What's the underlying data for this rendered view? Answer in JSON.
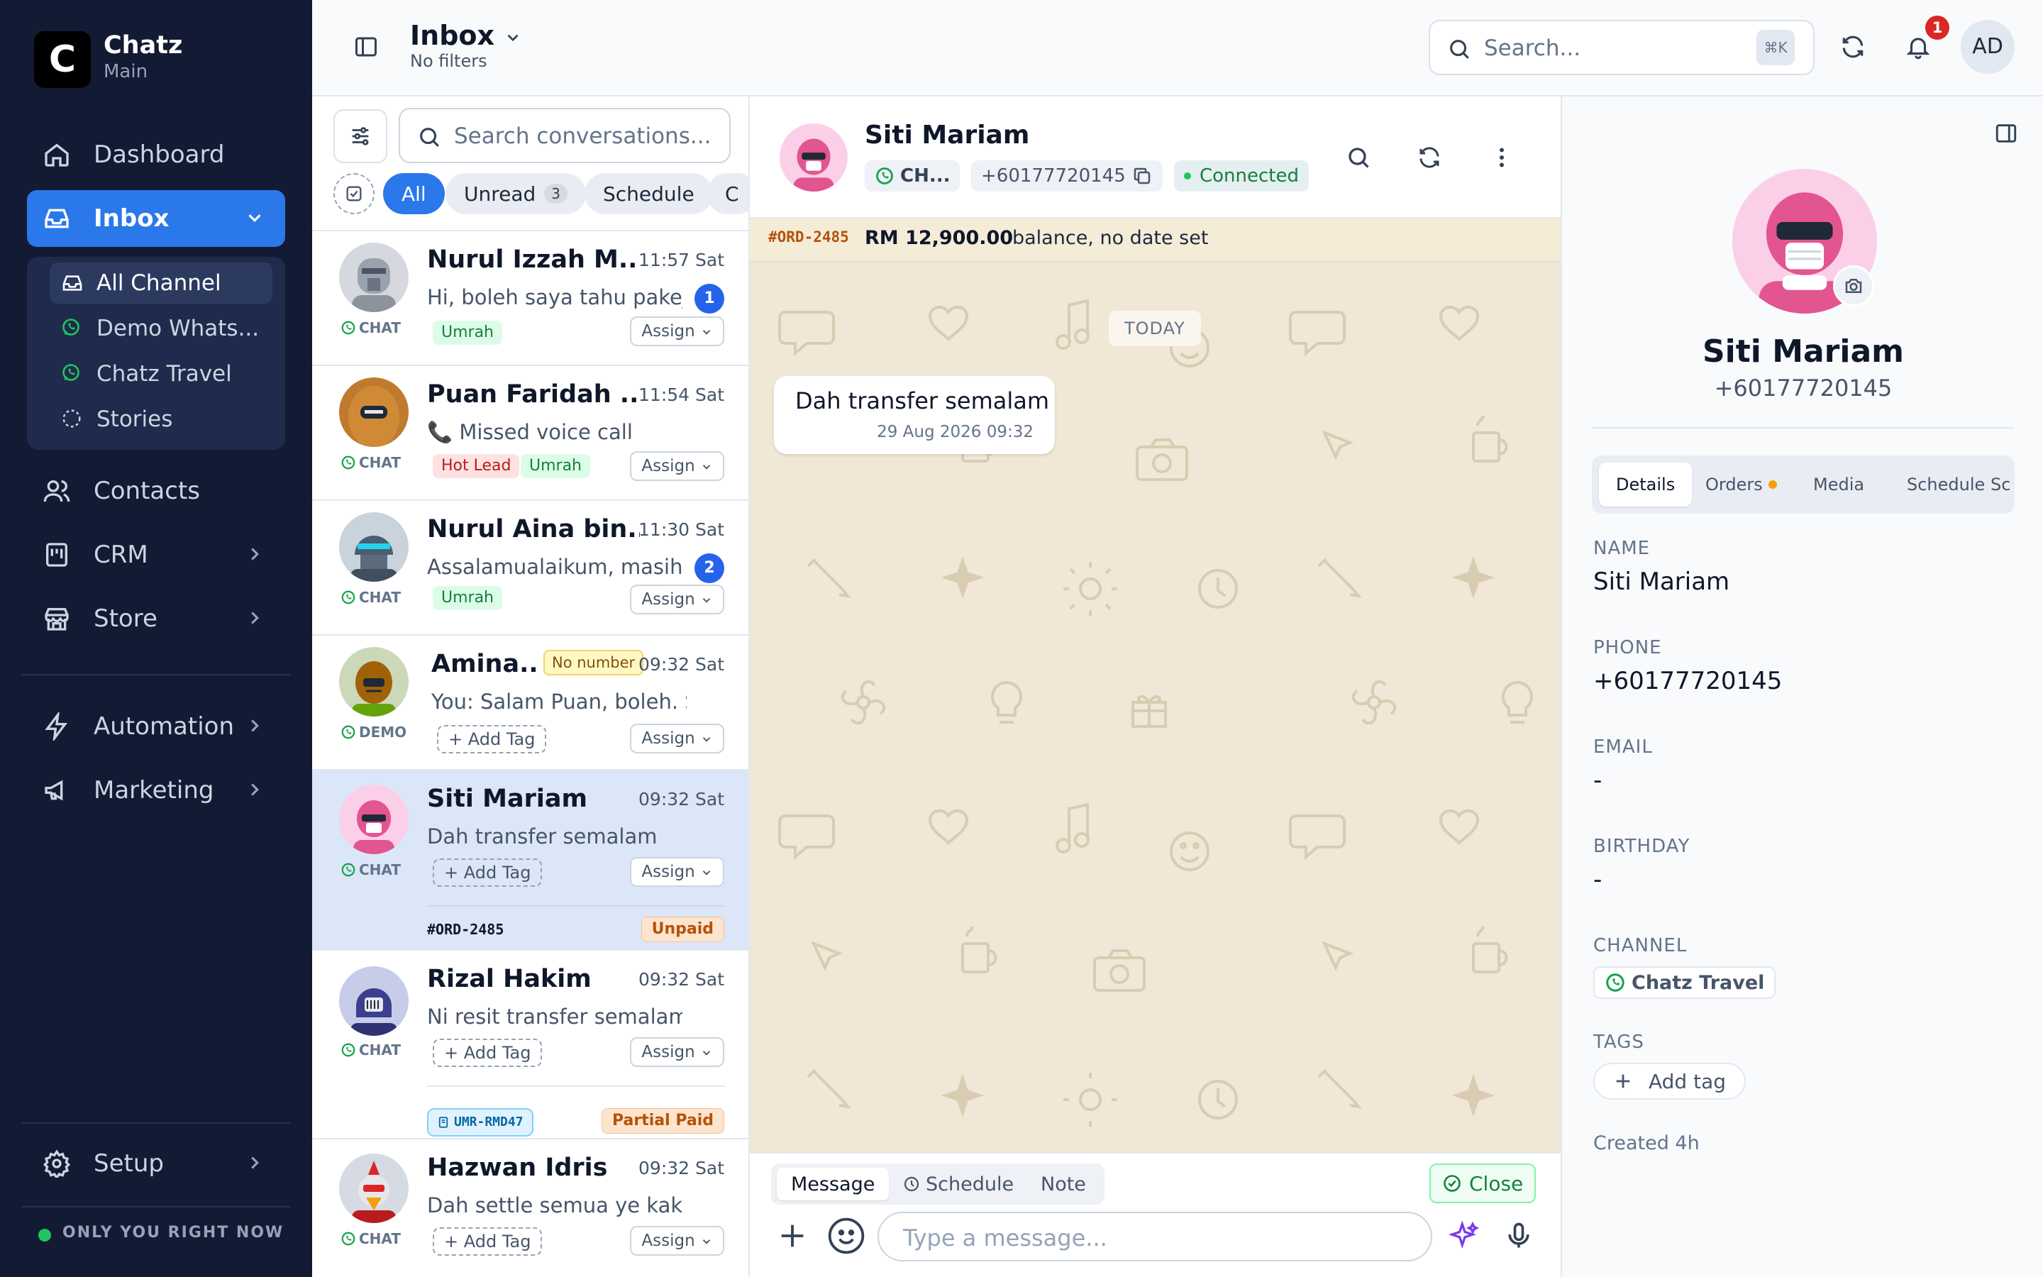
{
  "sidebar": {
    "brand": "Chatz",
    "brand_sub": "Main",
    "nav": [
      {
        "label": "Dashboard"
      },
      {
        "label": "Inbox"
      },
      {
        "label": "Contacts"
      },
      {
        "label": "CRM"
      },
      {
        "label": "Store"
      },
      {
        "label": "Automation"
      },
      {
        "label": "Marketing"
      },
      {
        "label": "Setup"
      }
    ],
    "inbox_sub": [
      {
        "label": "All Channel"
      },
      {
        "label": "Demo Whats..."
      },
      {
        "label": "Chatz Travel"
      },
      {
        "label": "Stories"
      }
    ],
    "status": "ONLY YOU RIGHT NOW"
  },
  "header": {
    "title": "Inbox",
    "subtitle": "No filters",
    "search_placeholder": "Search...",
    "shortcut": "⌘K",
    "notif_count": "1",
    "user_initials": "AD"
  },
  "convlist": {
    "search_placeholder": "Search conversations...",
    "chips": [
      {
        "label": "All"
      },
      {
        "label": "Unread",
        "count": "3"
      },
      {
        "label": "Schedule"
      },
      {
        "label": "C"
      }
    ],
    "items": [
      {
        "name": "Nurul Izzah M...",
        "time": "11:57 Sat",
        "msg": "Hi, boleh saya tahu pakej...",
        "channel": "CHAT",
        "unread": "1",
        "tags": [
          "Umrah"
        ],
        "assign": "Assign"
      },
      {
        "name": "Puan Faridah ...",
        "time": "11:54 Sat",
        "msg": "📞 Missed voice call",
        "channel": "CHAT",
        "tags": [
          "Hot Lead",
          "Umrah"
        ],
        "assign": "Assign"
      },
      {
        "name": "Nurul Aina bin...",
        "time": "11:30 Sat",
        "msg": "Assalamualaikum, masih ...",
        "channel": "CHAT",
        "unread": "2",
        "tags": [
          "Umrah"
        ],
        "assign": "Assign"
      },
      {
        "name": "Amina...",
        "badge": "No number",
        "time": "09:32 Sat",
        "msg": "You: Salam Puan, boleh. Say...",
        "channel": "DEMO",
        "add_tag": "+ Add Tag",
        "assign": "Assign"
      },
      {
        "name": "Siti Mariam",
        "time": "09:32 Sat",
        "msg": "Dah transfer semalam",
        "channel": "CHAT",
        "add_tag": "+ Add Tag",
        "assign": "Assign",
        "order": "#ORD-2485",
        "pay": "Unpaid"
      },
      {
        "name": "Rizal Hakim",
        "time": "09:32 Sat",
        "msg": "Ni resit transfer semalam",
        "channel": "CHAT",
        "add_tag": "+ Add Tag",
        "assign": "Assign",
        "order": "UMR-RMD47",
        "pay": "Partial Paid"
      },
      {
        "name": "Hazwan Idris",
        "time": "09:32 Sat",
        "msg": "Dah settle semua ye kak",
        "channel": "CHAT",
        "add_tag": "+ Add Tag",
        "assign": "Assign"
      }
    ]
  },
  "chat": {
    "name": "Siti Mariam",
    "channel_short": "CH...",
    "phone": "+60177720145",
    "status": "Connected",
    "order_code": "#ORD-2485",
    "order_amount": "RM 12,900.00",
    "order_note": "balance, no date set",
    "day_label": "TODAY",
    "message_text": "Dah transfer semalam",
    "message_time": "29 Aug 2026 09:32",
    "tabs": [
      {
        "label": "Message"
      },
      {
        "label": "Schedule"
      },
      {
        "label": "Note"
      }
    ],
    "close_label": "Close",
    "input_placeholder": "Type a message..."
  },
  "profile": {
    "name": "Siti Mariam",
    "phone": "+60177720145",
    "tabs": [
      {
        "label": "Details"
      },
      {
        "label": "Orders"
      },
      {
        "label": "Media"
      },
      {
        "label": "Schedule"
      },
      {
        "label": "Sc"
      }
    ],
    "fields": {
      "name_label": "NAME",
      "name_value": "Siti Mariam",
      "phone_label": "PHONE",
      "phone_value": "+60177720145",
      "email_label": "EMAIL",
      "email_value": "-",
      "birthday_label": "BIRTHDAY",
      "birthday_value": "-",
      "channel_label": "CHANNEL",
      "channel_value": "Chatz Travel",
      "tags_label": "TAGS",
      "add_tag": "Add tag",
      "created": "Created 4h"
    }
  },
  "colors": {
    "sidebar_bg": "#131a33",
    "accent": "#2b78ea",
    "chat_bg": "#f0e7d6",
    "whatsapp": "#22c55e"
  }
}
